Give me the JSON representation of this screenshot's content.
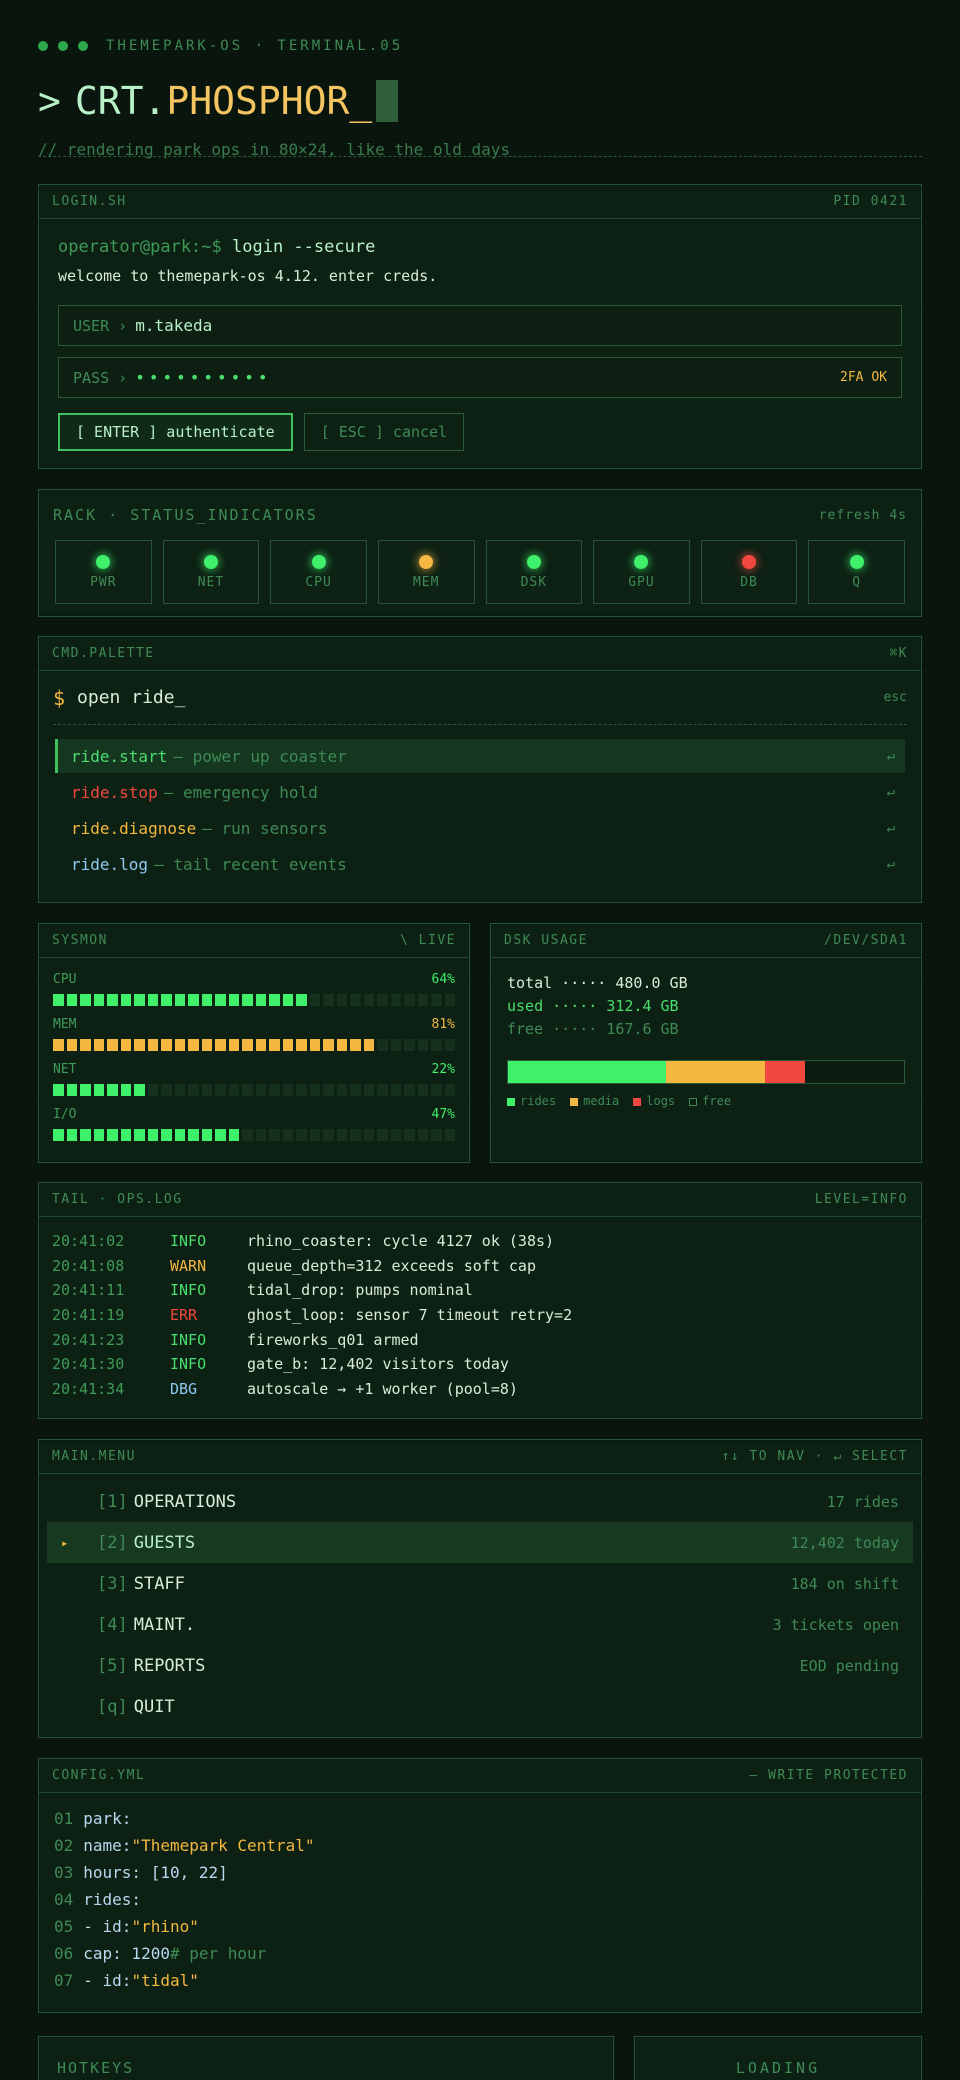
{
  "header": {
    "brand": "THEMEPARK-OS · TERMINAL.05",
    "prompt": ">",
    "title_a": "CRT.",
    "title_b": "PHOSPHOR_",
    "subtitle": "// rendering park ops in 80×24, like the old days"
  },
  "login": {
    "title": "LOGIN.SH",
    "pid": "PID 0421",
    "user_host": "operator@park:~$",
    "command": "login --secure",
    "welcome": "welcome to themepark-os 4.12. enter creds.",
    "user_label": "USER ›",
    "user_value": "m.takeda",
    "pass_label": "PASS ›",
    "pass_value": "••••••••••",
    "twofa": "2FA OK",
    "enter_label": "[ ENTER ] authenticate",
    "esc_label": "[ ESC ] cancel"
  },
  "rack": {
    "title": "RACK · STATUS_INDICATORS",
    "refresh": "refresh 4s",
    "indicators": [
      {
        "label": "PWR",
        "state": "ok",
        "color": "#3ef06a"
      },
      {
        "label": "NET",
        "state": "ok",
        "color": "#3ef06a"
      },
      {
        "label": "CPU",
        "state": "ok",
        "color": "#3ef06a"
      },
      {
        "label": "MEM",
        "state": "warn",
        "color": "#f4b740"
      },
      {
        "label": "DSK",
        "state": "ok",
        "color": "#3ef06a"
      },
      {
        "label": "GPU",
        "state": "ok",
        "color": "#3ef06a"
      },
      {
        "label": "DB",
        "state": "error",
        "color": "#f0483e"
      },
      {
        "label": "Q",
        "state": "ok",
        "color": "#3ef06a"
      }
    ]
  },
  "palette": {
    "title": "CMD.PALETTE",
    "shortcut": "⌘K",
    "prompt": "$",
    "query": "open ride_",
    "esc": "esc",
    "items": [
      {
        "cmd": "ride.start",
        "desc": "— power up coaster",
        "color": "#4ade6e",
        "selected": true
      },
      {
        "cmd": "ride.stop",
        "desc": "— emergency hold",
        "color": "#f0483e",
        "selected": false
      },
      {
        "cmd": "ride.diagnose",
        "desc": "— run sensors",
        "color": "#f4b740",
        "selected": false
      },
      {
        "cmd": "ride.log",
        "desc": "— tail recent events",
        "color": "#8fc8f0",
        "selected": false
      }
    ],
    "return_glyph": "↵"
  },
  "sysmon": {
    "title": "SYSMON",
    "status": "\\ LIVE",
    "meters": [
      {
        "label": "CPU",
        "value": 64,
        "display": "64%",
        "color": "#3ef06a"
      },
      {
        "label": "MEM",
        "value": 81,
        "display": "81%",
        "color": "#f4b740"
      },
      {
        "label": "NET",
        "value": 22,
        "display": "22%",
        "color": "#3ef06a"
      },
      {
        "label": "I/O",
        "value": 47,
        "display": "47%",
        "color": "#3ef06a"
      }
    ]
  },
  "disk": {
    "title": "DSK USAGE",
    "device": "/DEV/SDA1",
    "total_label": "total ·····",
    "total_value": "480.0 GB",
    "used_label": "used ·····",
    "used_value": "312.4 GB",
    "free_label": "free ·····",
    "free_value": "167.6 GB",
    "segments": [
      {
        "name": "rides",
        "fraction": 0.4,
        "color": "#3ef06a"
      },
      {
        "name": "media",
        "fraction": 0.25,
        "color": "#f4b740"
      },
      {
        "name": "logs",
        "fraction": 0.1,
        "color": "#f0483e"
      },
      {
        "name": "free",
        "fraction": 0.25,
        "color": "#0b1c10"
      }
    ]
  },
  "log": {
    "title": "TAIL · OPS.LOG",
    "level": "LEVEL=INFO",
    "rows": [
      {
        "time": "20:41:02",
        "level": "INFO",
        "msg": "rhino_coaster: cycle 4127 ok (38s)",
        "color": "#4ade6e"
      },
      {
        "time": "20:41:08",
        "level": "WARN",
        "msg": "queue_depth=312 exceeds soft cap",
        "color": "#f4b740"
      },
      {
        "time": "20:41:11",
        "level": "INFO",
        "msg": "tidal_drop: pumps nominal",
        "color": "#4ade6e"
      },
      {
        "time": "20:41:19",
        "level": "ERR",
        "msg": "ghost_loop: sensor 7 timeout retry=2",
        "color": "#f0483e"
      },
      {
        "time": "20:41:23",
        "level": "INFO",
        "msg": "fireworks_q01 armed",
        "color": "#4ade6e"
      },
      {
        "time": "20:41:30",
        "level": "INFO",
        "msg": "gate_b: 12,402 visitors today",
        "color": "#4ade6e"
      },
      {
        "time": "20:41:34",
        "level": "DBG",
        "msg": "autoscale → +1 worker (pool=8)",
        "color": "#8fc8f0"
      }
    ]
  },
  "menu": {
    "title": "MAIN.MENU",
    "hint": "↑↓ TO NAV · ↵ SELECT",
    "cursor": "▸",
    "items": [
      {
        "key": "[1]",
        "label": "OPERATIONS",
        "meta": "17 rides",
        "selected": false
      },
      {
        "key": "[2]",
        "label": "GUESTS",
        "meta": "12,402 today",
        "selected": true
      },
      {
        "key": "[3]",
        "label": "STAFF",
        "meta": "184 on shift",
        "selected": false
      },
      {
        "key": "[4]",
        "label": "MAINT.",
        "meta": "3 tickets open",
        "selected": false
      },
      {
        "key": "[5]",
        "label": "REPORTS",
        "meta": "EOD pending",
        "selected": false
      },
      {
        "key": "[q]",
        "label": "QUIT",
        "meta": "",
        "selected": false
      }
    ]
  },
  "config": {
    "title": "CONFIG.YML",
    "status": "— WRITE PROTECTED",
    "lines": [
      {
        "n": "01",
        "key": "park:",
        "str": "",
        "comment": ""
      },
      {
        "n": "02",
        "key": "name:",
        "str": "\"Themepark Central\"",
        "comment": ""
      },
      {
        "n": "03",
        "key": "hours: [10, 22]",
        "str": "",
        "comment": ""
      },
      {
        "n": "04",
        "key": "rides:",
        "str": "",
        "comment": ""
      },
      {
        "n": "05",
        "key": "- id:",
        "str": "\"rhino\"",
        "comment": ""
      },
      {
        "n": "06",
        "key": "cap: 1200",
        "str": "",
        "comment": "# per hour"
      },
      {
        "n": "07",
        "key": "- id:",
        "str": "\"tidal\"",
        "comment": ""
      }
    ]
  },
  "bottom": {
    "hotkeys": "HOTKEYS",
    "loading": "LOADING"
  }
}
